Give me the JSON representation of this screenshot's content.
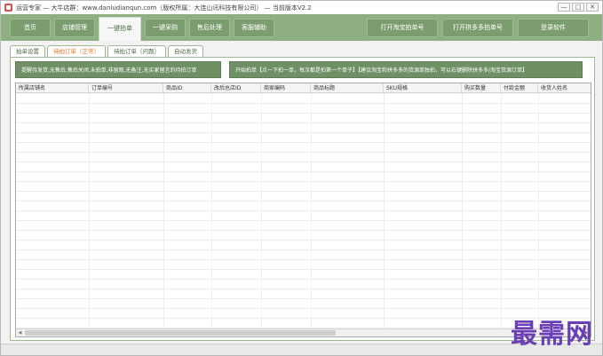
{
  "window": {
    "title": "运营专家 — 大牛店群：www.daniudianqun.com（版权所属：大连山讯科技有限公司） — 当前版本V2.2",
    "controls": [
      "—",
      "□",
      "✕"
    ]
  },
  "menubar": {
    "items": [
      "首页",
      "店铺管理",
      "一键拍单",
      "一键采购",
      "售后处理",
      "客服辅助"
    ],
    "active_index": 2,
    "right_items": [
      "打开淘宝拍单号",
      "打开拼多多拍单号",
      "登录软件"
    ]
  },
  "subtabs": {
    "items": [
      "拍单设置",
      "待拍订单（正常）",
      "待拍订单（问题）",
      "自动发货"
    ],
    "active_index": 1
  },
  "actions": {
    "filter_label": "提醒待发货,无售后,售后关闭,未拍单,非留观,无备注,无买家留言的待拍订单",
    "start_label": "开始拍单【点一下拍一单，每次都是拍第一个单子】【建议淘宝和拼多多的货源单独拍，可以右键删除拼多多/淘宝货源订单】"
  },
  "table": {
    "columns": [
      "所属店铺名",
      "订单编号",
      "商品ID",
      "改后总店ID",
      "商家编码",
      "商品标题",
      "SKU规格",
      "购买数量",
      "付款金额",
      "收货人姓名"
    ]
  },
  "watermark": "最需网",
  "colors": {
    "menubar": "#8faf82",
    "action_button": "#6f8f65",
    "active_subtab_text": "#e0782a",
    "watermark": "#6a3fb5"
  }
}
